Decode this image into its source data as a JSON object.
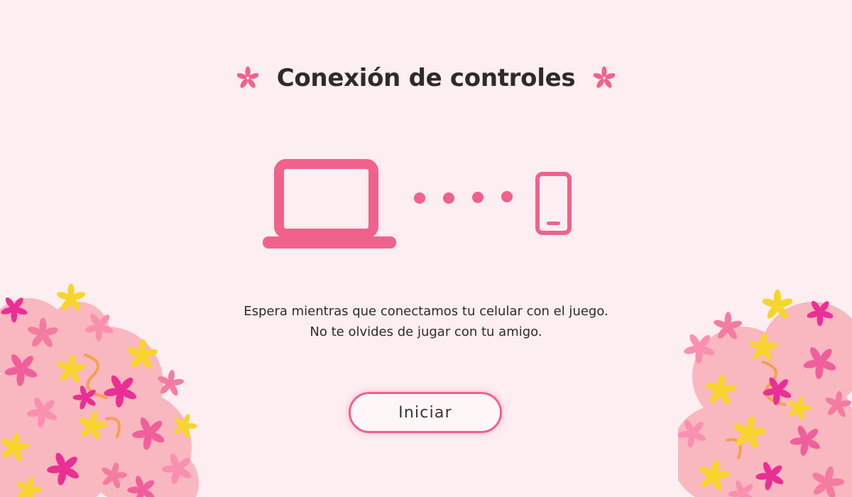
{
  "header": {
    "title": "Conexión de controles",
    "decoration_icon": "asterisk-flower-icon"
  },
  "illustration": {
    "left_device_icon": "laptop-icon",
    "right_device_icon": "smartphone-icon",
    "connector": "dots-connector"
  },
  "message": {
    "line1": "Espera mientras que conectamos tu celular con el juego.",
    "line2": "No te olvides de jugar con tu amigo."
  },
  "actions": {
    "start_label": "Iniciar"
  },
  "colors": {
    "background": "#fdeef1",
    "accent": "#f0628c",
    "text": "#2f2a2b",
    "flower_yellow": "#f7d52b",
    "flower_magenta": "#ea2f94",
    "bush_pink": "#f9b7bf"
  }
}
